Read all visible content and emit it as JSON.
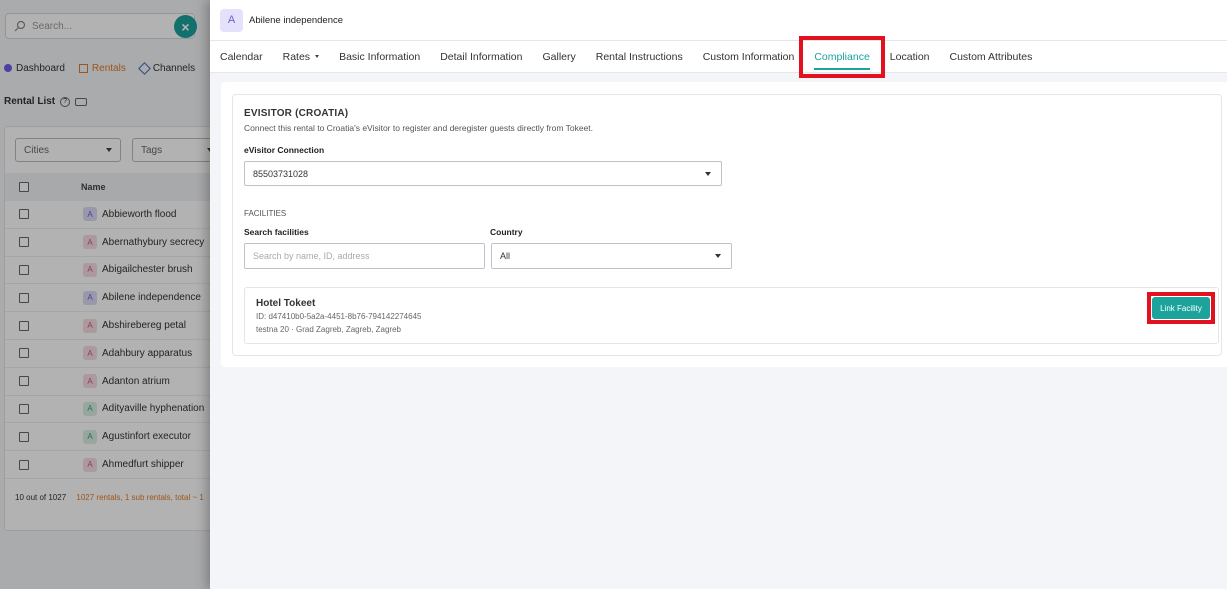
{
  "background": {
    "search_placeholder": "Search...",
    "close_symbol": "×",
    "nav": [
      {
        "label": "Dashboard",
        "active": false
      },
      {
        "label": "Rentals",
        "active": true
      },
      {
        "label": "Channels",
        "active": false
      }
    ],
    "page_title": "Rental List",
    "filters": {
      "cities": "Cities",
      "tags": "Tags"
    },
    "table_header": {
      "name": "Name"
    },
    "rows": [
      {
        "initial": "A",
        "name": "Abbieworth flood",
        "color": "purple"
      },
      {
        "initial": "A",
        "name": "Abernathybury secrecy",
        "color": "pink"
      },
      {
        "initial": "A",
        "name": "Abigailchester brush",
        "color": "pink"
      },
      {
        "initial": "A",
        "name": "Abilene independence",
        "color": "purple"
      },
      {
        "initial": "A",
        "name": "Abshirebereg petal",
        "color": "pink"
      },
      {
        "initial": "A",
        "name": "Adahbury apparatus",
        "color": "pink"
      },
      {
        "initial": "A",
        "name": "Adanton atrium",
        "color": "pink"
      },
      {
        "initial": "A",
        "name": "Adityaville hyphenation",
        "color": "green"
      },
      {
        "initial": "A",
        "name": "Agustinfort executor",
        "color": "green"
      },
      {
        "initial": "A",
        "name": "Ahmedfurt shipper",
        "color": "pink"
      }
    ],
    "footer": {
      "count": "10 out of 1027",
      "summary": "1027 rentals, 1 sub rentals, total ~ 1"
    }
  },
  "drawer": {
    "avatar_initial": "A",
    "rental_name": "Abilene independence",
    "tabs": [
      {
        "label": "Calendar",
        "active": false,
        "dropdown": false
      },
      {
        "label": "Rates",
        "active": false,
        "dropdown": true
      },
      {
        "label": "Basic Information",
        "active": false,
        "dropdown": false
      },
      {
        "label": "Detail Information",
        "active": false,
        "dropdown": false
      },
      {
        "label": "Gallery",
        "active": false,
        "dropdown": false
      },
      {
        "label": "Rental Instructions",
        "active": false,
        "dropdown": false
      },
      {
        "label": "Custom Information",
        "active": false,
        "dropdown": false
      },
      {
        "label": "Compliance",
        "active": true,
        "dropdown": false
      },
      {
        "label": "Location",
        "active": false,
        "dropdown": false
      },
      {
        "label": "Custom Attributes",
        "active": false,
        "dropdown": false
      }
    ],
    "compliance": {
      "section_title": "EVISITOR (CROATIA)",
      "description": "Connect this rental to Croatia's eVisitor to register and deregister guests directly from Tokeet.",
      "connection_label": "eVisitor Connection",
      "connection_value": "85503731028",
      "facilities_label": "FACILITIES",
      "search_label": "Search facilities",
      "search_placeholder": "Search by name, ID, address",
      "search_value": "",
      "country_label": "Country",
      "country_value": "All",
      "facility": {
        "name": "Hotel Tokeet",
        "id": "ID: d47410b0-5a2a-4451-8b76-794142274645",
        "address": "testna 20 · Grad Zagreb, Zagreb, Zagreb",
        "button_label": "Link Facility"
      }
    }
  },
  "colors": {
    "accent": "#1ba39c",
    "active_nav": "#e07b2a",
    "highlight_box": "#e3101f"
  }
}
